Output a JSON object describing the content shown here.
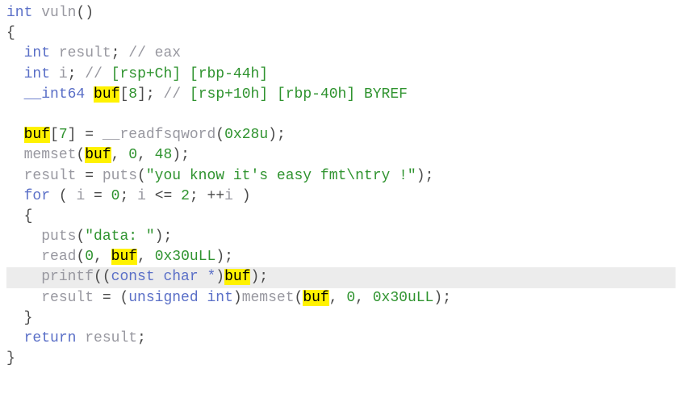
{
  "code": {
    "line1": {
      "type_int": "int",
      "func": "vuln",
      "empty_parens": "()"
    },
    "line2": {
      "brace": "{"
    },
    "line3": {
      "indent": "  ",
      "type": "int",
      "var": "result",
      "comment": "// eax"
    },
    "line4": {
      "indent": "  ",
      "type": "int",
      "var": "i",
      "comment_prefix": "// ",
      "comment_addr": "[rsp+Ch] [rbp-44h]"
    },
    "line5": {
      "indent": "  ",
      "type": "__int64",
      "var_hl": "buf",
      "arr": "[",
      "num": "8",
      "arr2": "]",
      "comment_prefix": "// ",
      "comment_addr": "[rsp+10h] [rbp-40h] BYREF"
    },
    "line7": {
      "indent": "  ",
      "var_hl": "buf",
      "brk_o": "[",
      "idx": "7",
      "brk_c": "]",
      "eq": " = ",
      "func": "__readfsqword",
      "par_o": "(",
      "arg": "0x28u",
      "par_c": ")",
      "semi": ";"
    },
    "line8": {
      "indent": "  ",
      "func": "memset",
      "par_o": "(",
      "var_hl": "buf",
      "comma1": ", ",
      "zero": "0",
      "comma2": ", ",
      "size": "48",
      "par_c": ")",
      "semi": ";"
    },
    "line9": {
      "indent": "  ",
      "var": "result",
      "eq": " = ",
      "func": "puts",
      "par_o": "(",
      "str": "\"you know it's easy fmt\\ntry !\"",
      "par_c": ")",
      "semi": ";"
    },
    "line10": {
      "indent": "  ",
      "kw": "for",
      "sp": " ",
      "par_o": "( ",
      "var_i": "i",
      "eq": " = ",
      "zero": "0",
      "semi1": "; ",
      "var_i2": "i",
      "le": " <= ",
      "two": "2",
      "semi2": "; ++",
      "var_i3": "i",
      "par_c": " )"
    },
    "line11": {
      "indent": "  ",
      "brace": "{"
    },
    "line12": {
      "indent": "    ",
      "func": "puts",
      "par_o": "(",
      "str": "\"data: \"",
      "par_c": ")",
      "semi": ";"
    },
    "line13": {
      "indent": "    ",
      "func": "read",
      "par_o": "(",
      "zero": "0",
      "comma1": ", ",
      "var_hl": "buf",
      "comma2": ", ",
      "size": "0x30uLL",
      "par_c": ")",
      "semi": ";"
    },
    "line14": {
      "indent": "    ",
      "func": "printf",
      "par_o": "((",
      "cast": "const char *",
      "par_c1": ")",
      "var_hl": "buf",
      "par_c2": ")",
      "semi": ";"
    },
    "line15": {
      "indent": "    ",
      "var": "result",
      "eq": " = ",
      "par_o": "(",
      "cast": "unsigned int",
      "par_c1": ")",
      "func": "memset",
      "par_o2": "(",
      "var_hl": "buf",
      "comma1": ", ",
      "zero": "0",
      "comma2": ", ",
      "size": "0x30uLL",
      "par_c2": ")",
      "semi": ";"
    },
    "line16": {
      "indent": "  ",
      "brace": "}"
    },
    "line17": {
      "indent": "  ",
      "kw": "return",
      "sp": " ",
      "var": "result",
      "semi": ";"
    },
    "line18": {
      "brace": "}"
    }
  }
}
